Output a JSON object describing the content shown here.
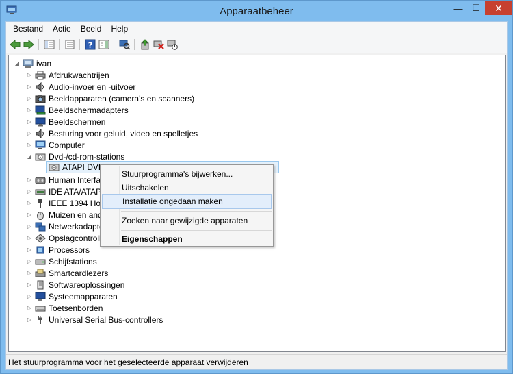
{
  "window": {
    "title": "Apparaatbeheer",
    "minimize": "—",
    "maximize": "☐",
    "close": "✕"
  },
  "menu": [
    "Bestand",
    "Actie",
    "Beeld",
    "Help"
  ],
  "tree": {
    "root": "ivan",
    "items": [
      "Afdrukwachtrijen",
      "Audio-invoer en -uitvoer",
      "Beeldapparaten (camera's en scanners)",
      "Beeldschermadapters",
      "Beeldschermen",
      "Besturing voor geluid, video en spelletjes",
      "Computer",
      "Dvd-/cd-rom-stations",
      "ATAPI DVD",
      "Human Interfac",
      "IDE ATA/ATAPI",
      "IEEE 1394 Host",
      "Muizen en ande",
      "Netwerkadapte",
      "Opslagcontrolle",
      "Processors",
      "Schijfstations",
      "Smartcardlezers",
      "Softwareoplossingen",
      "Systeemapparaten",
      "Toetsenborden",
      "Universal Serial Bus-controllers"
    ]
  },
  "context_menu": [
    "Stuurprogramma's bijwerken...",
    "Uitschakelen",
    "Installatie ongedaan maken",
    "Zoeken naar gewijzigde apparaten",
    "Eigenschappen"
  ],
  "status": "Het stuurprogramma voor het geselecteerde apparaat verwijderen"
}
